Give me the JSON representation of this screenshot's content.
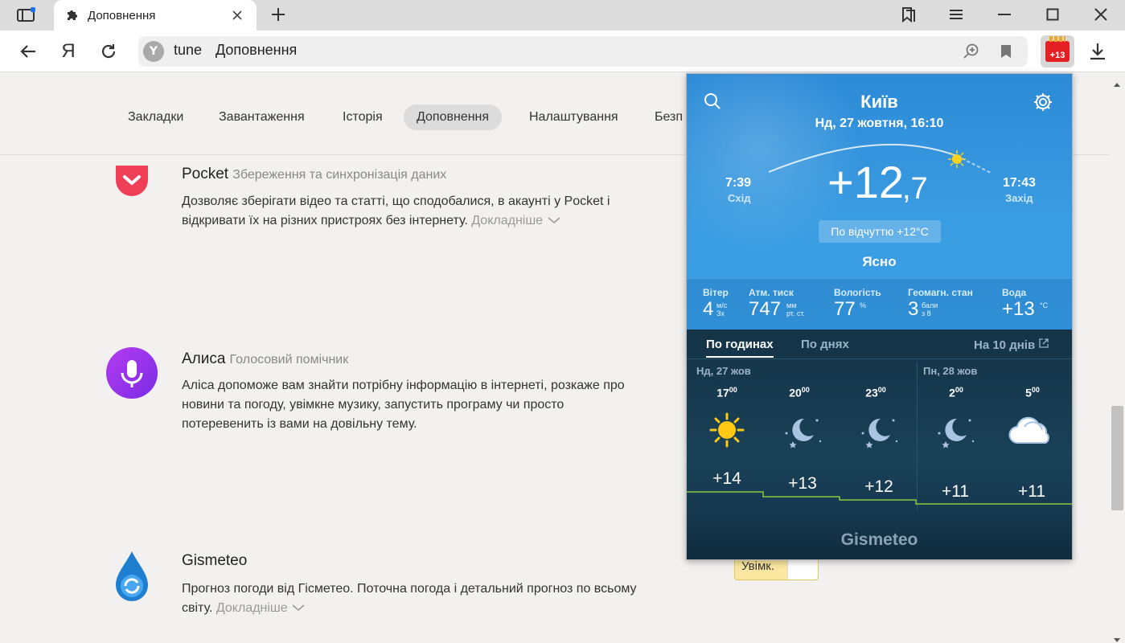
{
  "browser": {
    "tab_title": "Доповнення",
    "url_host": "tune",
    "url_title": "Доповнення",
    "url_logo_letter": "Y",
    "yandex_button": "Я",
    "ext_badge": "+13"
  },
  "settings_nav": {
    "items": [
      "Закладки",
      "Завантаження",
      "Історія",
      "Доповнення",
      "Налаштування",
      "Безп"
    ]
  },
  "extensions": [
    {
      "name": "Pocket",
      "subtitle": "Збереження та синхронізація даних",
      "desc1": "Дозволяє зберігати відео та статті, що сподобалися, в акаунті у Pocket і",
      "desc2": "відкривати їх на різних пристроях без інтернету.",
      "more": "Докладніше"
    },
    {
      "name": "Алиса",
      "subtitle": "Голосовий помічник",
      "desc1": "Аліса допоможе вам знайти потрібну інформацію в інтернеті, розкаже про",
      "desc2": "новини та погоду, увімкне музику, запустить програму чи просто",
      "desc3": "потеревенить із вами на довільну тему."
    },
    {
      "name": "Gismeteo",
      "desc1": "Прогноз погоди від Гісметео. Поточна погода і детальний прогноз по всьому",
      "desc2": "світу.",
      "more": "Докладніше",
      "toggle": "Увімк."
    }
  ],
  "weather": {
    "city": "Київ",
    "date": "Нд, 27 жовтня, 16:10",
    "sunrise": "7:39",
    "sunrise_label": "Схід",
    "sunset": "17:43",
    "sunset_label": "Захід",
    "temp_main": "+12",
    "temp_dec": ",7",
    "feels": "По відчуттю +12°C",
    "condition": "Ясно",
    "stats": {
      "wind_label": "Вітер",
      "wind_value": "4",
      "wind_unit1": "м/с",
      "wind_unit2": "Зх",
      "pressure_label": "Атм. тиск",
      "pressure_value": "747",
      "pressure_unit1": "мм",
      "pressure_unit2": "рт. ст.",
      "humidity_label": "Вологість",
      "humidity_value": "77",
      "humidity_unit": "%",
      "geomag_label": "Геомагн. стан",
      "geomag_value": "3",
      "geomag_unit1": "бали",
      "geomag_unit2": "з 8",
      "water_label": "Вода",
      "water_value": "+13",
      "water_unit": "°C"
    },
    "tabs": {
      "hours": "По годинах",
      "days": "По днях",
      "ten": "На 10 днів"
    },
    "day1": "Нд, 27 жов",
    "day2": "Пн, 28 жов",
    "hours": [
      {
        "h": "17",
        "m": "00",
        "icon": "sun-icon",
        "temp": "+14"
      },
      {
        "h": "20",
        "m": "00",
        "icon": "moon-icon",
        "temp": "+13"
      },
      {
        "h": "23",
        "m": "00",
        "icon": "moon-icon",
        "temp": "+12"
      },
      {
        "h": "2",
        "m": "00",
        "icon": "moon-icon",
        "temp": "+11"
      },
      {
        "h": "5",
        "m": "00",
        "icon": "cloud-icon",
        "temp": "+11"
      }
    ],
    "brand": "Gismeteo"
  }
}
